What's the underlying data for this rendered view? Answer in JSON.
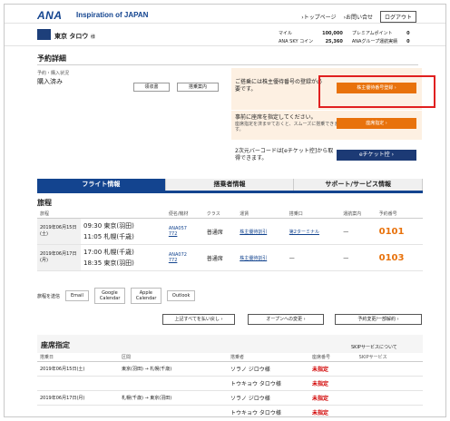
{
  "header": {
    "logo": "ANA",
    "tagline": "Inspiration of JAPAN",
    "links": [
      "トップページ",
      "お問い合せ"
    ],
    "logout": "ログアウト"
  },
  "user": {
    "name": "東京 タロウ",
    "honorific": "様",
    "stats": [
      {
        "label": "マイル",
        "value": "100,000",
        "label2": "プレミアムポイント",
        "value2": "0"
      },
      {
        "label": "ANA SKY コイン",
        "value": "25,360",
        "label2": "ANAグループ運航実績",
        "value2": "0"
      }
    ]
  },
  "reservation": {
    "title": "予約詳細",
    "status_label": "予約・購入状況",
    "status_value": "購入済み",
    "receipt_button": "領収書",
    "guide_button": "搭乗案内"
  },
  "panel": {
    "row1_text": "ご搭乗には株主優待番号の登録が必要です。",
    "row1_button": "株主優待番号登録",
    "row2_text": "事前に座席を指定してください。",
    "row2_sub": "座席指定を済ませておくと、スムーズに搭乗できます。",
    "row2_button": "座席指定",
    "row3_text": "2次元バーコードは[eチケット控]から取得できます。",
    "row3_button": "eチケット控"
  },
  "tabs": [
    "フライト情報",
    "搭乗者情報",
    "サポート/サービス情報"
  ],
  "itinerary": {
    "title": "旅程",
    "headers": [
      "旅程",
      "",
      "便名/機材",
      "クラス",
      "運賃",
      "搭乗口",
      "運航案内",
      "予約番号"
    ],
    "rows": [
      {
        "date": "2019年06月15日(土)",
        "dep_time": "09:30",
        "dep_place": "東京(羽田)",
        "arr_time": "11:05",
        "arr_place": "札幌(千歳)",
        "flight": "ANA057",
        "aircraft": "772",
        "class": "普通席",
        "fare": "株主優待割引",
        "gate": "第2ターミナル",
        "ops": "—",
        "res": "0101"
      },
      {
        "date": "2019年06月17日(月)",
        "dep_time": "17:00",
        "dep_place": "札幌(千歳)",
        "arr_time": "18:35",
        "arr_place": "東京(羽田)",
        "flight": "ANA072",
        "aircraft": "772",
        "class": "普通席",
        "fare": "株主優待割引",
        "gate": "—",
        "ops": "—",
        "res": "0103"
      }
    ]
  },
  "send": {
    "label": "旅程を送信",
    "buttons": [
      "Email",
      "Google Calendar",
      "Apple Calendar",
      "Outlook"
    ]
  },
  "actions": [
    "上記すべてを払い戻し",
    "オープンへの変更",
    "予約変更/一部解約"
  ],
  "seats": {
    "title": "座席指定",
    "service_link": "SKIPサービスについて",
    "headers": [
      "搭乗日",
      "区間",
      "搭乗者",
      "座席番号",
      "SKIPサービス"
    ],
    "rows": [
      {
        "date": "2019年06月15日(土)",
        "route": "東京(羽田) → 札幌(千歳)",
        "pax": "ソラノ ジロウ様",
        "seat": "未指定"
      },
      {
        "date": "",
        "route": "",
        "pax": "トウキョウ タロウ様",
        "seat": "未指定"
      },
      {
        "date": "2019年06月17日(月)",
        "route": "札幌(千歳) → 東京(羽田)",
        "pax": "ソラノ ジロウ様",
        "seat": "未指定"
      },
      {
        "date": "",
        "route": "",
        "pax": "トウキョウ タロウ様",
        "seat": "未指定"
      }
    ]
  },
  "colors": {
    "brand": "#13448f",
    "accent": "#e8720c",
    "highlight": "#e02020",
    "navy": "#1c3a75"
  }
}
